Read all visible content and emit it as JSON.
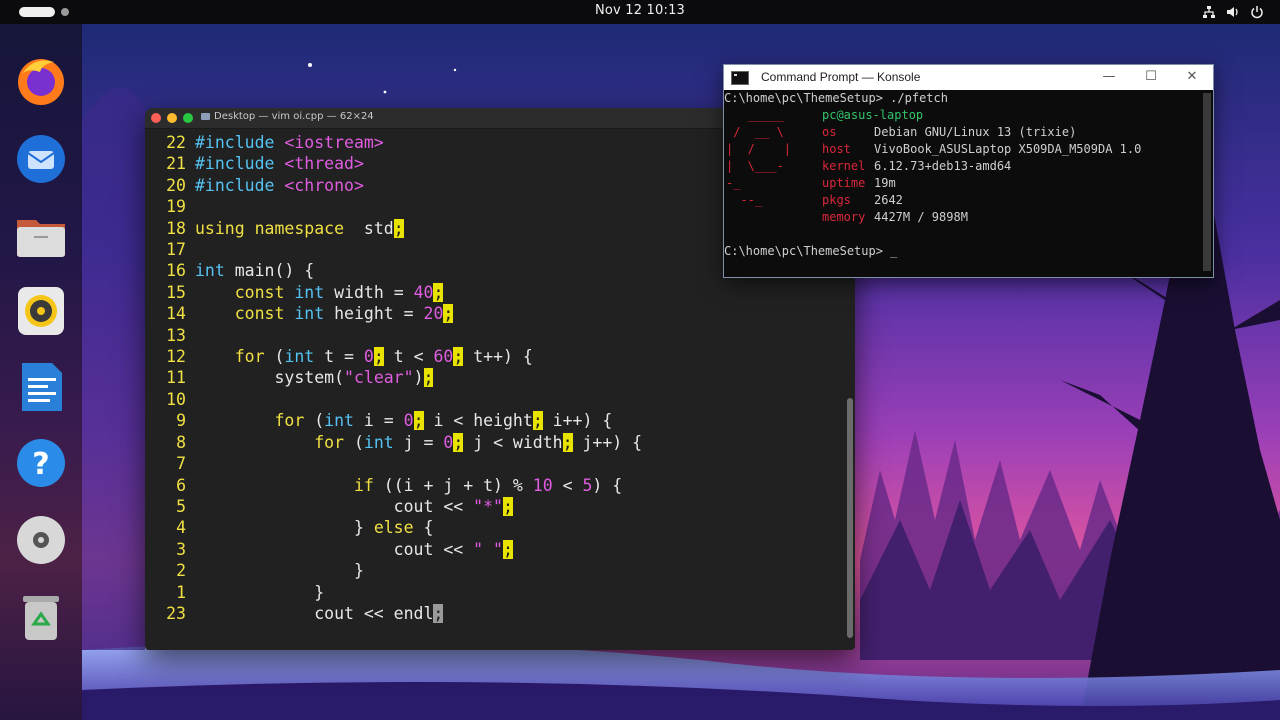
{
  "topbar": {
    "clock": "Nov 12  10:13",
    "tray_icons": [
      "network-icon",
      "volume-icon",
      "power-icon"
    ]
  },
  "dock": {
    "items": [
      "firefox",
      "thunderbird",
      "files",
      "rhythmbox",
      "libreoffice-writer",
      "help",
      "disc",
      "trash"
    ]
  },
  "vim": {
    "title": "Desktop — vim oi.cpp — 62×24",
    "lines": [
      {
        "n": "22",
        "segs": [
          [
            "pp",
            "#include "
          ],
          [
            "inc",
            "<iostream>"
          ]
        ]
      },
      {
        "n": "21",
        "segs": [
          [
            "pp",
            "#include "
          ],
          [
            "inc",
            "<thread>"
          ]
        ]
      },
      {
        "n": "20",
        "segs": [
          [
            "pp",
            "#include "
          ],
          [
            "inc",
            "<chrono>"
          ]
        ]
      },
      {
        "n": "19",
        "segs": []
      },
      {
        "n": "18",
        "segs": [
          [
            "kw",
            "using namespace"
          ],
          [
            "",
            "  std"
          ],
          [
            "hl",
            ";"
          ]
        ]
      },
      {
        "n": "17",
        "segs": []
      },
      {
        "n": "16",
        "segs": [
          [
            "ty",
            "int"
          ],
          [
            "",
            " main() {"
          ]
        ]
      },
      {
        "n": "15",
        "segs": [
          [
            "",
            "    "
          ],
          [
            "kw",
            "const"
          ],
          [
            "",
            " "
          ],
          [
            "ty",
            "int"
          ],
          [
            "",
            " width = "
          ],
          [
            "num",
            "40"
          ],
          [
            "hl",
            ";"
          ]
        ]
      },
      {
        "n": "14",
        "segs": [
          [
            "",
            "    "
          ],
          [
            "kw",
            "const"
          ],
          [
            "",
            " "
          ],
          [
            "ty",
            "int"
          ],
          [
            "",
            " height = "
          ],
          [
            "num",
            "20"
          ],
          [
            "hl",
            ";"
          ]
        ]
      },
      {
        "n": "13",
        "segs": []
      },
      {
        "n": "12",
        "segs": [
          [
            "",
            "    "
          ],
          [
            "kw",
            "for"
          ],
          [
            "",
            " ("
          ],
          [
            "ty",
            "int"
          ],
          [
            "",
            " t = "
          ],
          [
            "num",
            "0"
          ],
          [
            "hl",
            ";"
          ],
          [
            "",
            " t < "
          ],
          [
            "num",
            "60"
          ],
          [
            "hl",
            ";"
          ],
          [
            "",
            " t++) {"
          ]
        ]
      },
      {
        "n": "11",
        "segs": [
          [
            "",
            "        system("
          ],
          [
            "str",
            "\"clear\""
          ],
          [
            "",
            ")"
          ],
          [
            "hl",
            ";"
          ]
        ]
      },
      {
        "n": "10",
        "segs": []
      },
      {
        "n": "9",
        "segs": [
          [
            "",
            "        "
          ],
          [
            "kw",
            "for"
          ],
          [
            "",
            " ("
          ],
          [
            "ty",
            "int"
          ],
          [
            "",
            " i = "
          ],
          [
            "num",
            "0"
          ],
          [
            "hl",
            ";"
          ],
          [
            "",
            " i < height"
          ],
          [
            "hl",
            ";"
          ],
          [
            "",
            " i++) {"
          ]
        ]
      },
      {
        "n": "8",
        "segs": [
          [
            "",
            "            "
          ],
          [
            "kw",
            "for"
          ],
          [
            "",
            " ("
          ],
          [
            "ty",
            "int"
          ],
          [
            "",
            " j = "
          ],
          [
            "num",
            "0"
          ],
          [
            "hl",
            ";"
          ],
          [
            "",
            " j < width"
          ],
          [
            "hl",
            ";"
          ],
          [
            "",
            " j++) {"
          ]
        ]
      },
      {
        "n": "7",
        "segs": []
      },
      {
        "n": "6",
        "segs": [
          [
            "",
            "                "
          ],
          [
            "kw",
            "if"
          ],
          [
            "",
            " ((i + j + t) % "
          ],
          [
            "num",
            "10"
          ],
          [
            "",
            " < "
          ],
          [
            "num",
            "5"
          ],
          [
            "",
            ") {"
          ]
        ]
      },
      {
        "n": "5",
        "segs": [
          [
            "",
            "                    cout << "
          ],
          [
            "str",
            "\"*\""
          ],
          [
            "hl",
            ";"
          ]
        ]
      },
      {
        "n": "4",
        "segs": [
          [
            "",
            "                } "
          ],
          [
            "kw",
            "else"
          ],
          [
            "",
            " {"
          ]
        ]
      },
      {
        "n": "3",
        "segs": [
          [
            "",
            "                    cout << "
          ],
          [
            "str",
            "\" \""
          ],
          [
            "hl",
            ";"
          ]
        ]
      },
      {
        "n": "2",
        "segs": [
          [
            "",
            "                }"
          ]
        ]
      },
      {
        "n": "1",
        "segs": [
          [
            "",
            "            }"
          ]
        ]
      },
      {
        "n": "23",
        "segs": [
          [
            "",
            "            cout << endl"
          ],
          [
            "hlc",
            ";"
          ]
        ]
      }
    ]
  },
  "konsole": {
    "title": "Command Prompt — Konsole",
    "controls": {
      "minimize": "—",
      "maximize": "☐",
      "close": "✕"
    },
    "prompt1": "C:\\home\\pc\\ThemeSetup> ./pfetch",
    "user": "pc@asus-laptop",
    "info": [
      {
        "key": "os",
        "value": "Debian GNU/Linux 13 (trixie)"
      },
      {
        "key": "host",
        "value": "VivoBook_ASUSLaptop X509DA_M509DA 1.0"
      },
      {
        "key": "kernel",
        "value": "6.12.73+deb13-amd64"
      },
      {
        "key": "uptime",
        "value": "19m"
      },
      {
        "key": "pkgs",
        "value": "2642"
      },
      {
        "key": "memory",
        "value": "4427M / 9898M"
      }
    ],
    "logo": [
      "   _____",
      " /  __ \\",
      "|  /    |",
      "|  \\___-",
      "-_",
      "  --_"
    ],
    "prompt2": "C:\\home\\pc\\ThemeSetup> _"
  }
}
